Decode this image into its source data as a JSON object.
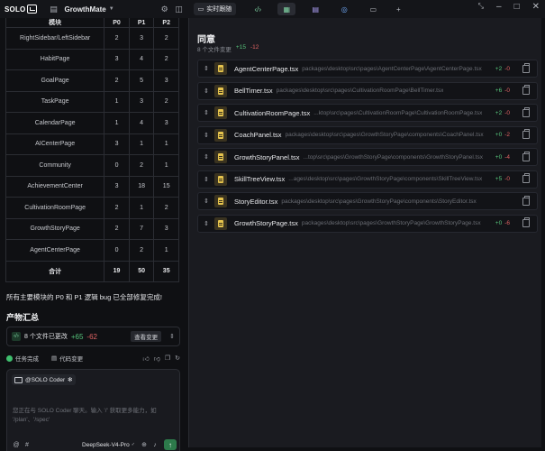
{
  "titlebar": {
    "app_name": "SOLO",
    "project_name": "GrowthMate",
    "live_tab_label": "实时跟随"
  },
  "table": {
    "headers": [
      "模块",
      "P0",
      "P1",
      "P2"
    ],
    "rows": [
      [
        "RightSidebar/LeftSidebar",
        "2",
        "3",
        "2"
      ],
      [
        "HabitPage",
        "3",
        "4",
        "2"
      ],
      [
        "GoalPage",
        "2",
        "5",
        "3"
      ],
      [
        "TaskPage",
        "1",
        "3",
        "2"
      ],
      [
        "CalendarPage",
        "1",
        "4",
        "3"
      ],
      [
        "AICenterPage",
        "3",
        "1",
        "1"
      ],
      [
        "Community",
        "0",
        "2",
        "1"
      ],
      [
        "AchievementCenter",
        "3",
        "18",
        "15"
      ],
      [
        "CultivationRoomPage",
        "2",
        "1",
        "2"
      ],
      [
        "GrowthStoryPage",
        "2",
        "7",
        "3"
      ],
      [
        "AgentCenterPage",
        "0",
        "2",
        "1"
      ]
    ],
    "total": [
      "合计",
      "19",
      "50",
      "35"
    ]
  },
  "left": {
    "summary": "所有主要模块的 P0 和 P1 逻辑 bug 已全部修复完成!",
    "section_title": "产物汇总",
    "changes": {
      "text": "8 个文件已更改",
      "added": "+65",
      "removed": "-62",
      "view_button": "查看变更"
    },
    "status": {
      "task_done": "任务完成",
      "code_changes": "代码变更"
    },
    "input": {
      "agent_label": "@SOLO Coder",
      "placeholder": "您正在与 SOLO Coder 聊天。输入 '/' 获取更多能力，如 '/plan'、'/spec'",
      "model": "DeepSeek-V4-Pro"
    }
  },
  "right": {
    "title": "同意",
    "subtitle": "8 个文件变更",
    "added": "+15",
    "removed": "-12",
    "files": [
      {
        "name": "AgentCenterPage.tsx",
        "path": "packages\\desktop\\src\\pages\\AgentCenterPage\\AgentCenterPage.tsx",
        "added": "+2",
        "removed": "-0"
      },
      {
        "name": "BellTimer.tsx",
        "path": "packages\\desktop\\src\\pages\\CultivationRoomPage\\BellTimer.tsx",
        "added": "+6",
        "removed": "-0"
      },
      {
        "name": "CultivationRoomPage.tsx",
        "path": "...ktop\\src\\pages\\CultivationRoomPage\\CultivationRoomPage.tsx",
        "added": "+2",
        "removed": "-0"
      },
      {
        "name": "CoachPanel.tsx",
        "path": "packages\\desktop\\src\\pages\\GrowthStoryPage\\components\\CoachPanel.tsx",
        "added": "+0",
        "removed": "-2"
      },
      {
        "name": "GrowthStoryPanel.tsx",
        "path": "...top\\src\\pages\\GrowthStoryPage\\components\\GrowthStoryPanel.tsx",
        "added": "+0",
        "removed": "-4"
      },
      {
        "name": "SkillTreeView.tsx",
        "path": "...ages\\desktop\\src\\pages\\GrowthStoryPage\\components\\SkillTreeView.tsx",
        "added": "+5",
        "removed": "-0"
      },
      {
        "name": "StoryEditor.tsx",
        "path": "packages\\desktop\\src\\pages\\GrowthStoryPage\\components\\StoryEditor.tsx",
        "added": "",
        "removed": ""
      },
      {
        "name": "GrowthStoryPage.tsx",
        "path": "packages\\desktop\\src\\pages\\GrowthStoryPage\\GrowthStoryPage.tsx",
        "added": "+0",
        "removed": "-6"
      }
    ]
  },
  "colors": {
    "accent_green": "#55c27a",
    "accent_red": "#e26464",
    "file_icon": "#e6c44d"
  }
}
